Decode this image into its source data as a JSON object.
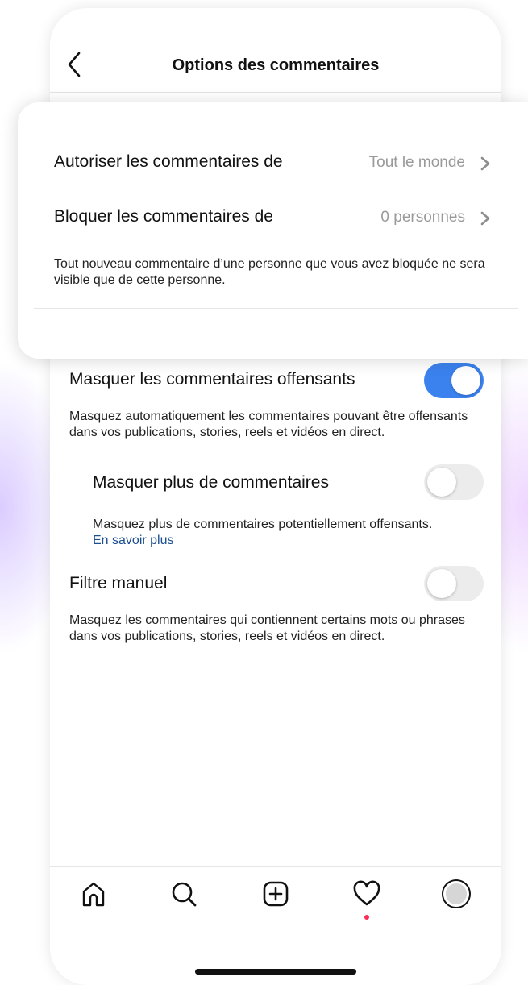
{
  "header": {
    "title": "Options des commentaires",
    "back_icon": "chevron-left-icon"
  },
  "comment_controls": {
    "allow": {
      "label": "Autoriser les commentaires de",
      "value": "Tout le monde"
    },
    "block": {
      "label": "Bloquer les commentaires de",
      "value": "0 personnes"
    },
    "note": "Tout nouveau commentaire d’une personne que vous avez bloquée ne sera visible que de cette personne."
  },
  "filters": {
    "hide_offensive": {
      "label": "Masquer les commentaires offensants",
      "enabled": true,
      "description": "Masquez automatiquement les commentaires pouvant être offensants dans vos publications, stories, reels et vidéos en direct."
    },
    "hide_more": {
      "label": "Masquer plus de commentaires",
      "enabled": false,
      "description": "Masquez plus de commentaires potentiellement offensants.",
      "link": "En savoir plus"
    },
    "manual_filter": {
      "label": "Filtre manuel",
      "enabled": false,
      "description": "Masquez les commentaires qui contiennent certains mots ou phrases dans vos publications, stories, reels et vidéos en direct."
    }
  },
  "tabbar": {
    "items": [
      "home-icon",
      "search-icon",
      "create-icon",
      "heart-icon",
      "profile-icon"
    ],
    "has_notification": true
  },
  "colors": {
    "toggle_on": "#3b82ee",
    "toggle_off": "#ececec",
    "link": "#1c4f8f",
    "notification": "#ff2d55"
  }
}
